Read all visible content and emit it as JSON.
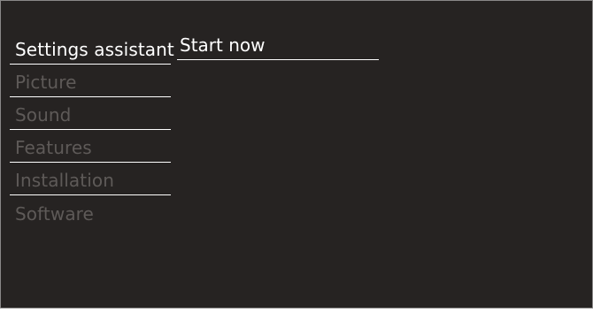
{
  "menu": {
    "items": [
      {
        "label": "Settings assistant"
      },
      {
        "label": "Picture"
      },
      {
        "label": "Sound"
      },
      {
        "label": "Features"
      },
      {
        "label": "Installation"
      },
      {
        "label": "Software"
      }
    ],
    "selected_index": 0
  },
  "submenu": {
    "items": [
      {
        "label": "Start now"
      }
    ]
  },
  "colors": {
    "background": "#262322",
    "active_text": "#ffffff",
    "inactive_text": "#5e5a58",
    "divider": "#ffffff",
    "frame_border": "#8a8888"
  }
}
